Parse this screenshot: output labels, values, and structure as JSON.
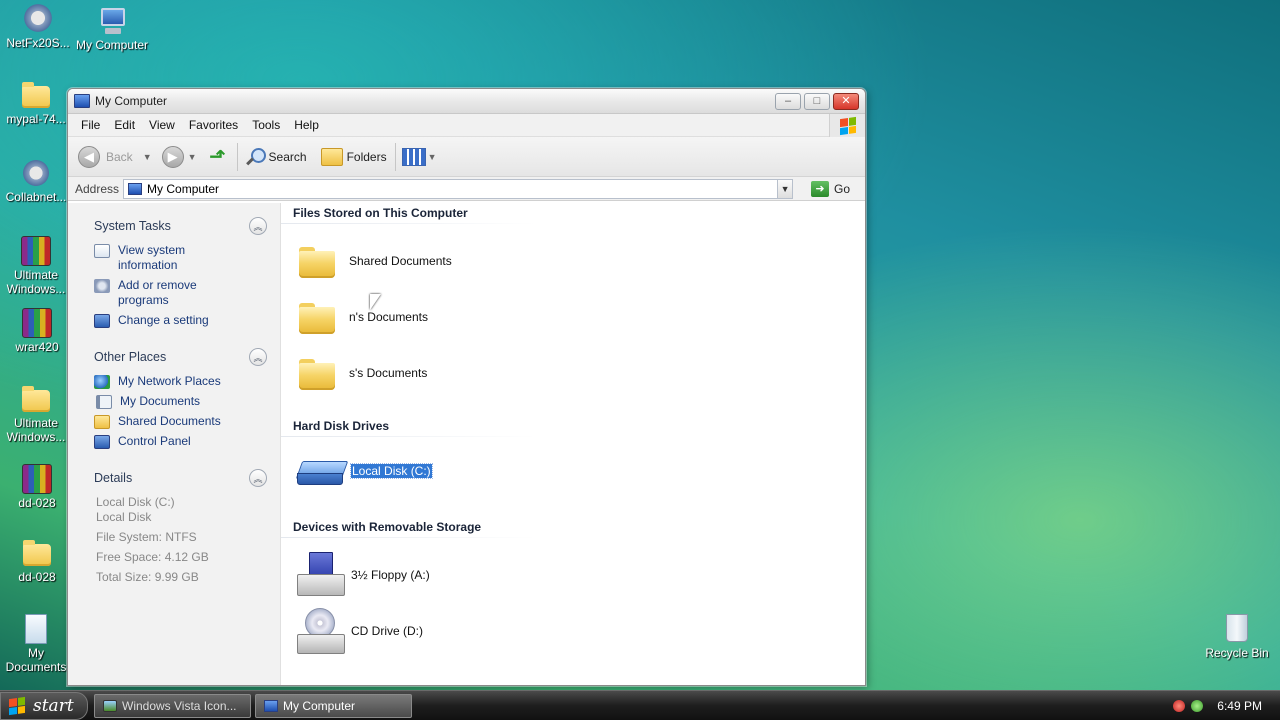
{
  "desktop": {
    "icons": [
      {
        "label": "NetFx20S...",
        "icon": "installer-icon"
      },
      {
        "label": "My Computer",
        "icon": "computer-icon"
      },
      {
        "label": "mypal-74...",
        "icon": "folder-icon"
      },
      {
        "label": "Collabnet...",
        "icon": "setup-icon"
      },
      {
        "label": "Ultimate Windows...",
        "icon": "winrar-archive-icon"
      },
      {
        "label": "wrar420",
        "icon": "winrar-installer-icon"
      },
      {
        "label": "Ultimate Windows...",
        "icon": "folder-icon"
      },
      {
        "label": "dd-028",
        "icon": "winrar-archive-icon"
      },
      {
        "label": "dd-028",
        "icon": "folder-icon"
      },
      {
        "label": "My Documents",
        "icon": "documents-icon"
      },
      {
        "label": "Recycle Bin",
        "icon": "recycle-bin-icon"
      }
    ]
  },
  "window": {
    "title": "My Computer",
    "buttons": {
      "minimize": "–",
      "maximize": "□",
      "close": "✕"
    },
    "menu": [
      "File",
      "Edit",
      "View",
      "Favorites",
      "Tools",
      "Help"
    ],
    "toolbar": {
      "back": "Back",
      "search": "Search",
      "folders": "Folders"
    },
    "address": {
      "label": "Address",
      "value": "My Computer",
      "go": "Go"
    },
    "taskpane": {
      "system_tasks": {
        "title": "System Tasks",
        "links": [
          "View system information",
          "Add or remove programs",
          "Change a setting"
        ]
      },
      "other_places": {
        "title": "Other Places",
        "links": [
          "My Network Places",
          "My Documents",
          "Shared Documents",
          "Control Panel"
        ]
      },
      "details": {
        "title": "Details",
        "name": "Local Disk (C:)",
        "type": "Local Disk",
        "file_system": "File System: NTFS",
        "free_space": "Free Space: 4.12 GB",
        "total_size": "Total Size: 9.99 GB"
      }
    },
    "groups": {
      "files": {
        "title": "Files Stored on This Computer",
        "items": [
          "Shared Documents",
          "n's Documents",
          "s's Documents"
        ]
      },
      "hard_disks": {
        "title": "Hard Disk Drives",
        "items": [
          "Local Disk (C:)"
        ]
      },
      "removable": {
        "title": "Devices with Removable Storage",
        "items": [
          "3½ Floppy (A:)",
          "CD Drive (D:)"
        ]
      }
    }
  },
  "taskbar": {
    "start": "start",
    "tasks": [
      {
        "label": "Windows Vista Icon...",
        "active": false
      },
      {
        "label": "My Computer",
        "active": true
      }
    ],
    "clock": "6:49 PM"
  }
}
